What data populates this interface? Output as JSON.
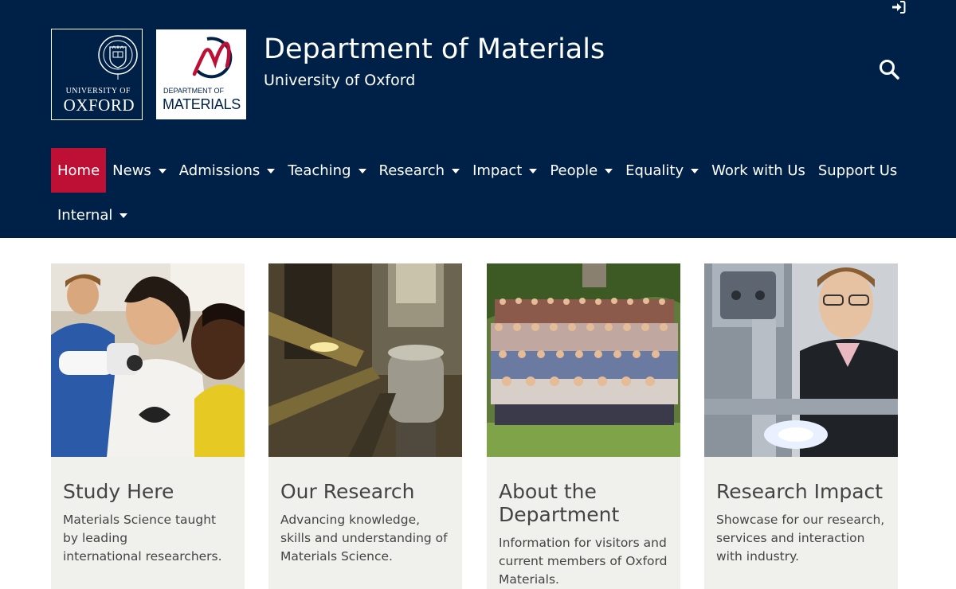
{
  "header": {
    "title": "Department of Materials",
    "subtitle": "University of Oxford",
    "oxford_logo": {
      "line1": "UNIVERSITY OF",
      "line2": "OXFORD"
    },
    "dept_logo": {
      "line1": "DEPARTMENT OF",
      "line2": "MATERIALS"
    },
    "icons": {
      "login": "sign-in-icon",
      "search": "search-icon"
    }
  },
  "nav": {
    "items": [
      {
        "label": "Home",
        "active": true,
        "dropdown": false
      },
      {
        "label": "News",
        "active": false,
        "dropdown": true
      },
      {
        "label": "Admissions",
        "active": false,
        "dropdown": true
      },
      {
        "label": "Teaching",
        "active": false,
        "dropdown": true
      },
      {
        "label": "Research",
        "active": false,
        "dropdown": true
      },
      {
        "label": "Impact",
        "active": false,
        "dropdown": true
      },
      {
        "label": "People",
        "active": false,
        "dropdown": true
      },
      {
        "label": "Equality",
        "active": false,
        "dropdown": true
      },
      {
        "label": "Work with Us",
        "active": false,
        "dropdown": false
      },
      {
        "label": "Support Us",
        "active": false,
        "dropdown": false
      },
      {
        "label": "Internal",
        "active": false,
        "dropdown": true
      }
    ]
  },
  "cards": [
    {
      "title": "Study Here",
      "description": "Materials Science taught by leading\ninternational researchers."
    },
    {
      "title": "Our Research",
      "description": "Advancing knowledge, skills and understanding of Materials  Science."
    },
    {
      "title": "About the Department",
      "description": "Information for visitors and current members of Oxford Materials."
    },
    {
      "title": "Research Impact",
      "description": "Showcase for our research, services and interaction with industry."
    }
  ],
  "colors": {
    "header_bg": "#002147",
    "active_nav": "#be0f34",
    "card_bg": "#f0f0ec",
    "text": "#444444"
  }
}
